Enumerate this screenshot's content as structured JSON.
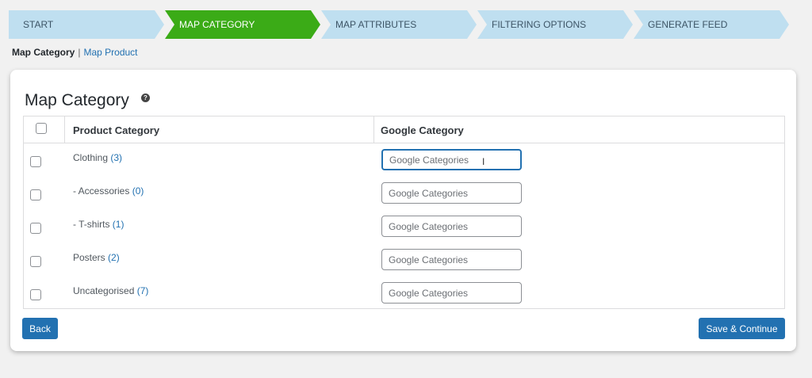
{
  "steps": [
    {
      "label": "START",
      "active": false
    },
    {
      "label": "MAP CATEGORY",
      "active": true
    },
    {
      "label": "MAP ATTRIBUTES",
      "active": false
    },
    {
      "label": "FILTERING OPTIONS",
      "active": false
    },
    {
      "label": "GENERATE FEED",
      "active": false
    }
  ],
  "subnav": {
    "current": "Map Category",
    "separator": "|",
    "link": "Map Product"
  },
  "card": {
    "title": "Map Category",
    "help_icon": "question-icon"
  },
  "table": {
    "headers": {
      "product": "Product Category",
      "google": "Google Category"
    },
    "rows": [
      {
        "name": "Clothing",
        "count": "(3)",
        "placeholder": "Google Categories"
      },
      {
        "name": "- Accessories",
        "count": "(0)",
        "placeholder": "Google Categories"
      },
      {
        "name": "- T-shirts",
        "count": "(1)",
        "placeholder": "Google Categories"
      },
      {
        "name": "Posters",
        "count": "(2)",
        "placeholder": "Google Categories"
      },
      {
        "name": "Uncategorised",
        "count": "(7)",
        "placeholder": "Google Categories"
      }
    ]
  },
  "buttons": {
    "back": "Back",
    "save": "Save & Continue"
  },
  "colors": {
    "active_step": "#3bab17",
    "inactive_step": "#bfdff0",
    "primary": "#2271b1"
  }
}
